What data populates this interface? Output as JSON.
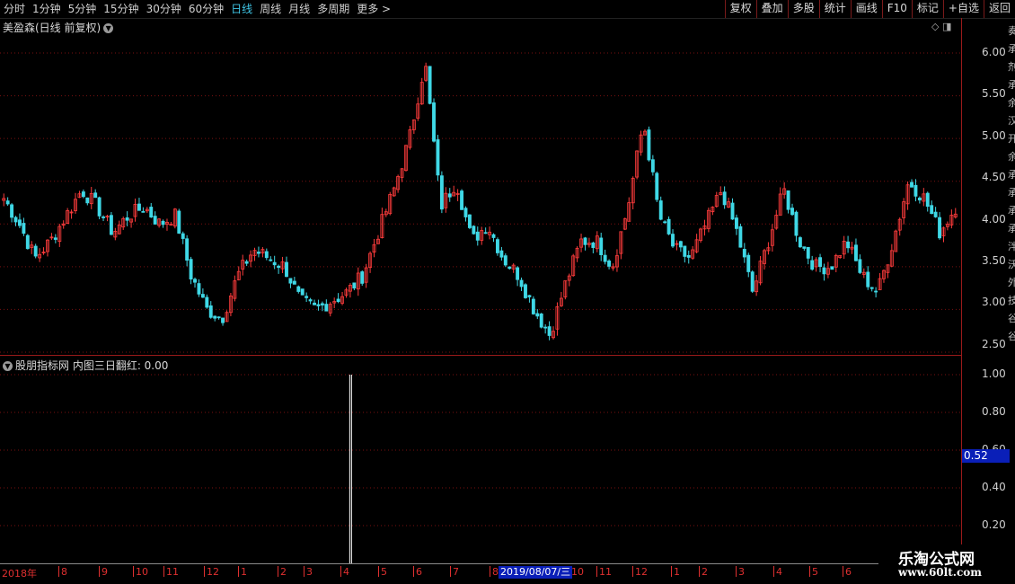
{
  "toolbar": {
    "periods": [
      "分时",
      "1分钟",
      "5分钟",
      "15分钟",
      "30分钟",
      "60分钟",
      "日线",
      "周线",
      "月线",
      "多周期",
      "更多 >"
    ],
    "active_period": "日线",
    "right_buttons": [
      "复权",
      "叠加",
      "多股",
      "统计",
      "画线",
      "F10",
      "标记",
      "+自选",
      "返回"
    ]
  },
  "main_chart": {
    "title": "美盈森(日线 前复权)",
    "price_labels": [
      "6.00",
      "5.50",
      "5.00",
      "4.50",
      "4.00",
      "3.50",
      "3.00",
      "2.50"
    ]
  },
  "indicator": {
    "title": "股朋指标网 内图三日翻红: 0.00",
    "axis_labels": [
      "1.00",
      "0.80",
      "0.60",
      "0.40",
      "0.20"
    ],
    "cursor_value": "0.52"
  },
  "date_axis": {
    "labels": [
      "2018年",
      "8",
      "9",
      "10",
      "11",
      "12",
      "1",
      "2",
      "3",
      "4",
      "5",
      "6",
      "7",
      "8",
      "9",
      "10",
      "11",
      "12",
      "1",
      "2",
      "3",
      "4",
      "5",
      "6"
    ],
    "selected_date": "2019/08/07/三"
  },
  "right_strip": [
    "奏",
    "承",
    "剂",
    "承",
    "余",
    "汉",
    "开",
    "余",
    "承",
    "承",
    "承",
    "承",
    "泮",
    "沃",
    "外",
    "技",
    "谷",
    "谷"
  ],
  "watermark": {
    "name": "乐淘公式网",
    "url": "www.60lt.com"
  },
  "colors": {
    "up": "#ff3c3c",
    "down": "#3fd8e6",
    "grid": "#7a1010",
    "accent_blue": "#0a1fb8"
  },
  "chart_data": {
    "type": "candlestick",
    "title": "美盈森(日线 前复权)",
    "ylim": [
      2.5,
      6.2
    ],
    "x_labels": [
      "2018年",
      "8",
      "9",
      "10",
      "11",
      "12",
      "1",
      "2",
      "3",
      "4",
      "5",
      "6",
      "7",
      "8",
      "9",
      "10",
      "11",
      "12",
      "1",
      "2",
      "3",
      "4",
      "5",
      "6"
    ],
    "close": [
      4.3,
      4.0,
      3.6,
      3.8,
      4.1,
      4.4,
      4.2,
      3.9,
      4.1,
      4.2,
      4.0,
      4.1,
      3.4,
      3.0,
      2.9,
      3.4,
      3.7,
      3.6,
      3.5,
      3.1,
      3.0,
      3.1,
      3.2,
      3.4,
      3.9,
      4.4,
      5.0,
      5.9,
      4.2,
      4.5,
      3.8,
      4.0,
      3.6,
      3.4,
      3.0,
      2.7,
      3.3,
      3.8,
      3.8,
      3.5,
      4.2,
      5.2,
      4.1,
      3.7,
      3.6,
      4.0,
      4.4,
      3.9,
      3.2,
      3.8,
      4.4,
      3.8,
      3.5,
      3.5,
      3.8,
      3.4,
      3.2,
      3.8,
      4.5,
      4.3,
      3.9,
      4.2
    ]
  },
  "indicator_data": {
    "type": "spike",
    "name": "内图三日翻红",
    "value": 0.0,
    "ylim": [
      0,
      1
    ],
    "spikes": [
      {
        "pos": 0.365,
        "value": 1.0
      }
    ]
  }
}
